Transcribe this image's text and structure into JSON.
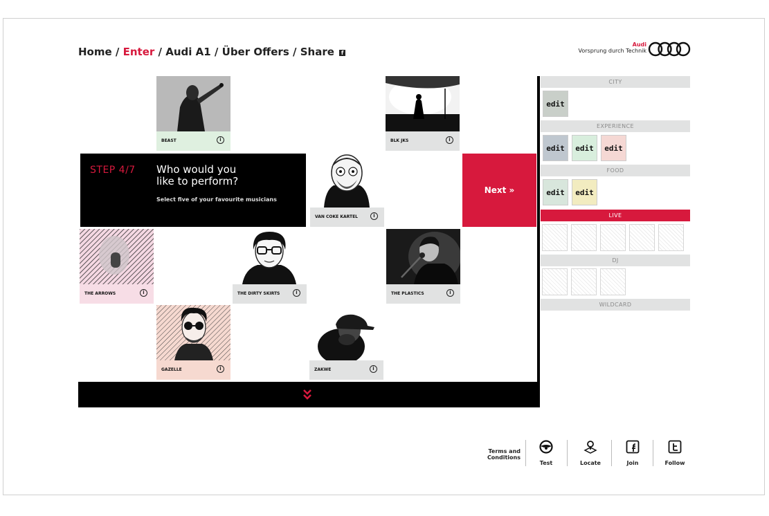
{
  "breadcrumb": {
    "home": "Home",
    "enter": "Enter",
    "audi_a1": "Audi A1",
    "uber_offers": "Über Offers",
    "share": "Share",
    "separator": "/"
  },
  "brand": {
    "name": "Audi",
    "tagline": "Vorsprung durch Technik",
    "logo_icon": "audi-rings-icon"
  },
  "step": {
    "label": "STEP 4/7",
    "question_line1": "Who would you",
    "question_line2": "like to perform?",
    "subtitle": "Select five of your favourite musicians"
  },
  "next_button": "Next »",
  "musicians": [
    {
      "name": "BEAST",
      "caption_color": "#dff0e0"
    },
    {
      "name": "BLK JKS",
      "caption_color": "#e1e2e2"
    },
    {
      "name": "VAN COKE KARTEL",
      "caption_color": "#e1e2e2"
    },
    {
      "name": "THE ARROWS",
      "caption_color": "#f7dde6"
    },
    {
      "name": "THE DIRTY SKIRTS",
      "caption_color": "#e1e2e2"
    },
    {
      "name": "THE PLASTICS",
      "caption_color": "#e1e2e2"
    },
    {
      "name": "GAZELLE",
      "caption_color": "#f6d9d0"
    },
    {
      "name": "ZAKWE",
      "caption_color": "#e1e2e2"
    }
  ],
  "info_symbol": "ⓘ",
  "scroll_down_icon": "double-chevron-down-icon",
  "sidebar": {
    "categories": [
      {
        "label": "CITY",
        "active": false
      },
      {
        "label": "EXPERIENCE",
        "active": false
      },
      {
        "label": "FOOD",
        "active": false
      },
      {
        "label": "LIVE",
        "active": true
      },
      {
        "label": "DJ",
        "active": false
      },
      {
        "label": "WILDCARD",
        "active": false
      }
    ],
    "edit_label": "edit",
    "edit_thumb_colors": {
      "city": "#c9cfc9",
      "experience_1": "#bfc7cf",
      "experience_2": "#d8eedd",
      "experience_3": "#f5d8d4",
      "food_1": "#d8e6dc",
      "food_2": "#f2ecc0"
    }
  },
  "footer": {
    "terms_line1": "Terms and",
    "terms_line2": "Conditions",
    "items": [
      {
        "label": "Test",
        "icon": "steering-wheel-icon"
      },
      {
        "label": "Locate",
        "icon": "map-pin-icon"
      },
      {
        "label": "Join",
        "icon": "facebook-icon"
      },
      {
        "label": "Follow",
        "icon": "twitter-icon"
      }
    ]
  },
  "colors": {
    "accent_red": "#d7193d",
    "black": "#000000",
    "category_bar": "#e1e2e2"
  }
}
